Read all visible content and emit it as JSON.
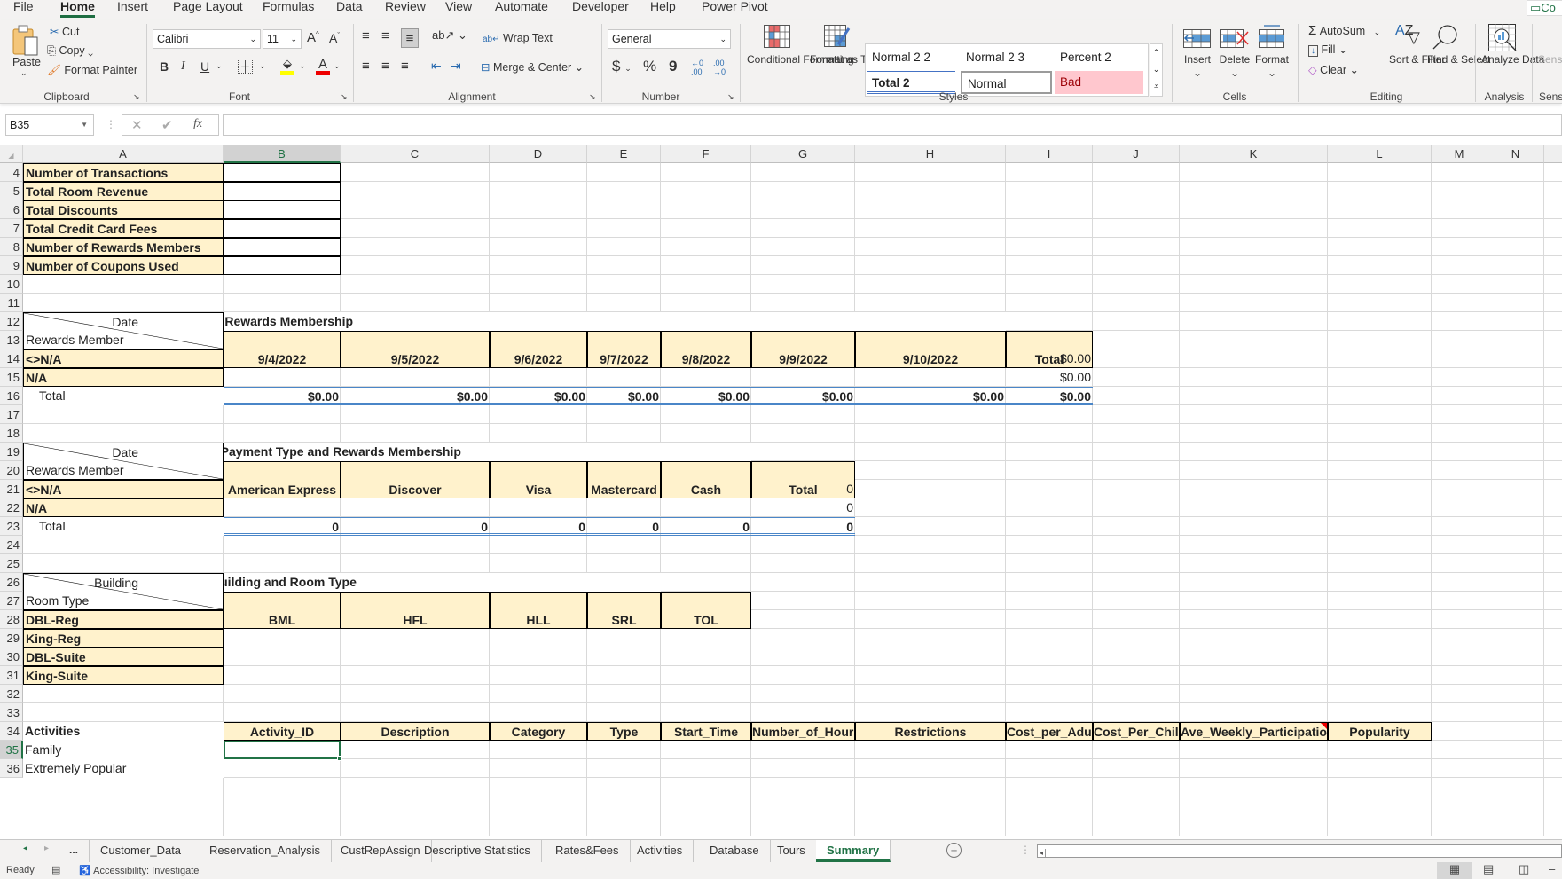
{
  "menu": [
    "File",
    "Home",
    "Insert",
    "Page Layout",
    "Formulas",
    "Data",
    "Review",
    "View",
    "Automate",
    "Developer",
    "Help",
    "Power Pivot"
  ],
  "comments_button": "Co",
  "ribbon": {
    "clipboard": {
      "paste": "Paste",
      "cut": "Cut",
      "copy": "Copy",
      "format_painter": "Format Painter",
      "label": "Clipboard"
    },
    "font": {
      "name": "Calibri",
      "size": "11",
      "bold": "B",
      "italic": "I",
      "underline": "U",
      "label": "Font"
    },
    "alignment": {
      "wrap_text": "Wrap Text",
      "merge_center": "Merge & Center",
      "label": "Alignment"
    },
    "number": {
      "format": "General",
      "currency": "$",
      "percent": "%",
      "comma": "9",
      "label": "Number"
    },
    "styles": {
      "conditional_formatting": "Conditional Formatting",
      "format_as_table": "Format as Table",
      "cells": [
        "Normal 2 2",
        "Normal 2 3",
        "Percent 2",
        "Total 2",
        "Normal",
        "Bad"
      ],
      "label": "Styles"
    },
    "cells": {
      "insert": "Insert",
      "delete": "Delete",
      "format": "Format",
      "label": "Cells"
    },
    "editing": {
      "autosum": "AutoSum",
      "fill": "Fill",
      "clear": "Clear",
      "sort_filter": "Sort & Filter",
      "find_select": "Find & Select",
      "label": "Editing"
    },
    "analysis": {
      "analyze_data": "Analyze Data",
      "label": "Analysis"
    },
    "sensitivity": {
      "label": "Sens",
      "button": "Sens"
    }
  },
  "formula_bar": {
    "name_box": "B35",
    "value": "",
    "fx": "fx"
  },
  "columns": [
    "A",
    "B",
    "C",
    "D",
    "E",
    "F",
    "G",
    "H",
    "I",
    "J",
    "K",
    "L",
    "M",
    "N"
  ],
  "rows": [
    "4",
    "5",
    "6",
    "7",
    "8",
    "9",
    "10",
    "11",
    "12",
    "13",
    "14",
    "15",
    "16",
    "17",
    "18",
    "19",
    "20",
    "21",
    "22",
    "23",
    "24",
    "25",
    "26",
    "27",
    "28",
    "29",
    "30",
    "31",
    "32",
    "33",
    "34",
    "35",
    "36"
  ],
  "summary_labels": [
    "Number of Transactions",
    "Total Room Revenue",
    "Total Discounts",
    "Total Credit Card Fees",
    "Number of Rewards Members",
    "Number of Coupons Used"
  ],
  "revenue_table": {
    "title": "Total Room Revenue by Date and Rewards Membership",
    "corner_top": "Date",
    "corner_bottom": "Rewards Member",
    "headers": [
      "9/4/2022",
      "9/5/2022",
      "9/6/2022",
      "9/7/2022",
      "9/8/2022",
      "9/9/2022",
      "9/10/2022",
      "Total"
    ],
    "rows": [
      {
        "label": "<>N/A",
        "total": "$0.00"
      },
      {
        "label": "N/A",
        "total": "$0.00"
      }
    ],
    "total_label": "Total",
    "totals": [
      "$0.00",
      "$0.00",
      "$0.00",
      "$0.00",
      "$0.00",
      "$0.00",
      "$0.00",
      "$0.00"
    ]
  },
  "transactions_table": {
    "title": "Total Number of Transactions by Payment Type and Rewards Membership",
    "corner_top": "Date",
    "corner_bottom": "Rewards Member",
    "headers": [
      "American Express",
      "Discover",
      "Visa",
      "Mastercard",
      "Cash",
      "Total"
    ],
    "rows": [
      {
        "label": "<>N/A",
        "total": "0"
      },
      {
        "label": "N/A",
        "total": "0"
      }
    ],
    "total_label": "Total",
    "totals": [
      "0",
      "0",
      "0",
      "0",
      "0",
      "0"
    ]
  },
  "nights_table": {
    "title": "Maximum Number of Nights by Building and Room Type",
    "corner_top": "Building",
    "corner_bottom": "Room Type",
    "headers": [
      "BML",
      "HFL",
      "HLL",
      "SRL",
      "TOL"
    ],
    "rows": [
      "DBL-Reg",
      "King-Reg",
      "DBL-Suite",
      "King-Suite"
    ]
  },
  "activities": {
    "title": "Activities",
    "headers": [
      "Activity_ID",
      "Description",
      "Category",
      "Type",
      "Start_Time",
      "Number_of_Hours",
      "Restrictions",
      "Cost_per_Adult",
      "Cost_Per_Child",
      "Ave_Weekly_Participation",
      "Popularity"
    ],
    "criteria": [
      "Family",
      "Extremely Popular"
    ]
  },
  "sheet_tabs": [
    "Customer_Data",
    "Reservation_Analysis",
    "CustRepAssign",
    "Descriptive Statistics",
    "Rates&Fees",
    "Activities",
    "Database",
    "Tours",
    "Summary"
  ],
  "active_tab": "Summary",
  "status": {
    "ready": "Ready",
    "accessibility": "Accessibility: Investigate"
  },
  "colors": {
    "accent": "#217346",
    "header_fill": "#fff2cc",
    "bad_fill": "#ffc7ce",
    "bad_text": "#9c0006"
  }
}
